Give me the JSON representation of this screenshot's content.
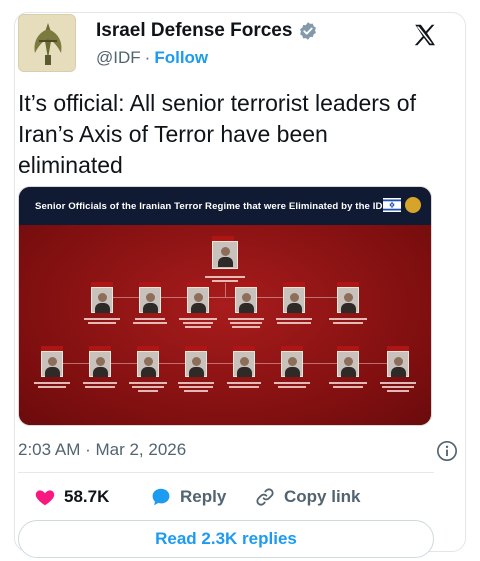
{
  "author": {
    "name": "Israel Defense Forces",
    "handle": "@IDF",
    "separator": "·",
    "follow_label": "Follow",
    "verified_color": "#829aab"
  },
  "tweet": {
    "text": "It’s official: All senior terrorist leaders of Iran’s Axis of Terror have been eliminated"
  },
  "media": {
    "title": "Senior Officials of the Iranian Terror Regime that were Eliminated by the IDF",
    "background_color": "#8a1212",
    "banner_color": "#111a33"
  },
  "meta": {
    "timestamp": "2:03 AM · Mar 2, 2026"
  },
  "actions": {
    "like_count": "58.7K",
    "reply_label": "Reply",
    "copy_link_label": "Copy link"
  },
  "read_replies_label": "Read 2.3K replies",
  "colors": {
    "accent": "#1d9bf0",
    "like": "#f91880",
    "muted": "#536471"
  },
  "icons": [
    "verified-badge-icon",
    "x-logo-icon",
    "info-icon",
    "heart-icon",
    "reply-bubble-icon",
    "link-icon"
  ]
}
